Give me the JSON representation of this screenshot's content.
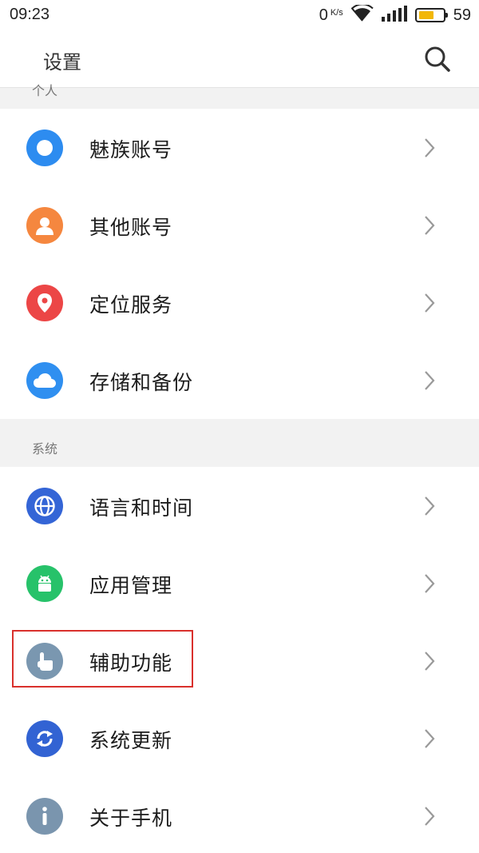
{
  "status_bar": {
    "time": "09:23",
    "net_speed": "0",
    "net_speed_unit": "K/s",
    "battery_level": "59",
    "battery_fraction": 0.59,
    "battery_color": "#f2b705"
  },
  "header": {
    "title": "设置",
    "search_icon": "search-icon"
  },
  "sections": {
    "personal_label": "个人",
    "system_label": "系统"
  },
  "rows": [
    {
      "label": "魅族账号",
      "icon": "flyme-account-icon",
      "color": "#2d8cf0"
    },
    {
      "label": "其他账号",
      "icon": "person-icon",
      "color": "#f5873f"
    },
    {
      "label": "定位服务",
      "icon": "location-pin-icon",
      "color": "#ec4646"
    },
    {
      "label": "存储和备份",
      "icon": "cloud-icon",
      "color": "#2f8ff0"
    },
    {
      "label": "语言和时间",
      "icon": "globe-icon",
      "color": "#3465d6"
    },
    {
      "label": "应用管理",
      "icon": "android-icon",
      "color": "#27c26a"
    },
    {
      "label": "辅助功能",
      "icon": "hand-pointer-icon",
      "color": "#7a97b0"
    },
    {
      "label": "系统更新",
      "icon": "refresh-icon",
      "color": "#3263d3"
    },
    {
      "label": "关于手机",
      "icon": "info-icon",
      "color": "#7a95ae"
    }
  ],
  "highlight_color": "#d9302c"
}
